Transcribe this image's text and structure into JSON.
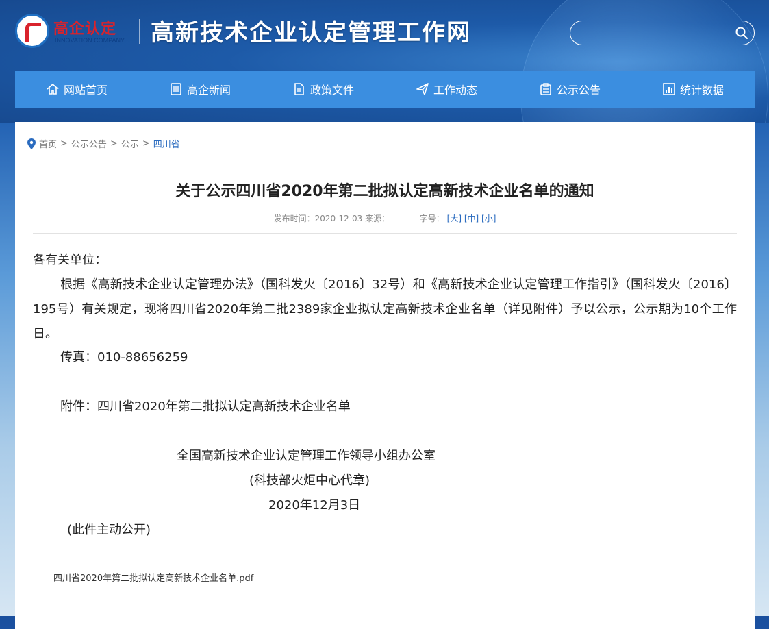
{
  "header": {
    "logo_cn": "高企认定",
    "logo_en": "INNOVATION COMPANY",
    "site_title": "高新技术企业认定管理工作网",
    "search_placeholder": ""
  },
  "nav": {
    "items": [
      {
        "label": "网站首页",
        "icon": "home-icon"
      },
      {
        "label": "高企新闻",
        "icon": "news-icon"
      },
      {
        "label": "政策文件",
        "icon": "document-icon"
      },
      {
        "label": "工作动态",
        "icon": "paper-plane-icon"
      },
      {
        "label": "公示公告",
        "icon": "clipboard-icon"
      },
      {
        "label": "统计数据",
        "icon": "chart-icon"
      }
    ]
  },
  "breadcrumb": {
    "items": [
      "首页",
      "公示公告",
      "公示"
    ],
    "current": "四川省",
    "separator": ">"
  },
  "article": {
    "title": "关于公示四川省2020年第二批拟认定高新技术企业名单的通知",
    "meta_date": "发布时间：2020-12-03 来源：",
    "meta_fontsize_label": "字号：",
    "size_large": "[大]",
    "size_medium": "[中]",
    "size_small": "[小]",
    "addressee": "各有关单位：",
    "main_paragraph": "根据《高新技术企业认定管理办法》（国科发火〔2016〕32号）和《高新技术企业认定管理工作指引》（国科发火〔2016〕195号）有关规定，现将四川省2020年第二批2389家企业拟认定高新技术企业名单（详见附件）予以公示，公示期为10个工作日。",
    "fax": "传真：010-88656259",
    "attachment_line": "附件：四川省2020年第二批拟认定高新技术企业名单",
    "signature_org": "全国高新技术企业认定管理工作领导小组办公室",
    "signature_sub": "(科技部火炬中心代章)",
    "date": "2020年12月3日",
    "public_note": "(此件主动公开)",
    "attachment_file": "四川省2020年第二批拟认定高新技术企业名单.pdf"
  },
  "colors": {
    "nav_bg": "#3b8ee0",
    "link": "#2a6bbf",
    "logo_red": "#d9232c"
  }
}
